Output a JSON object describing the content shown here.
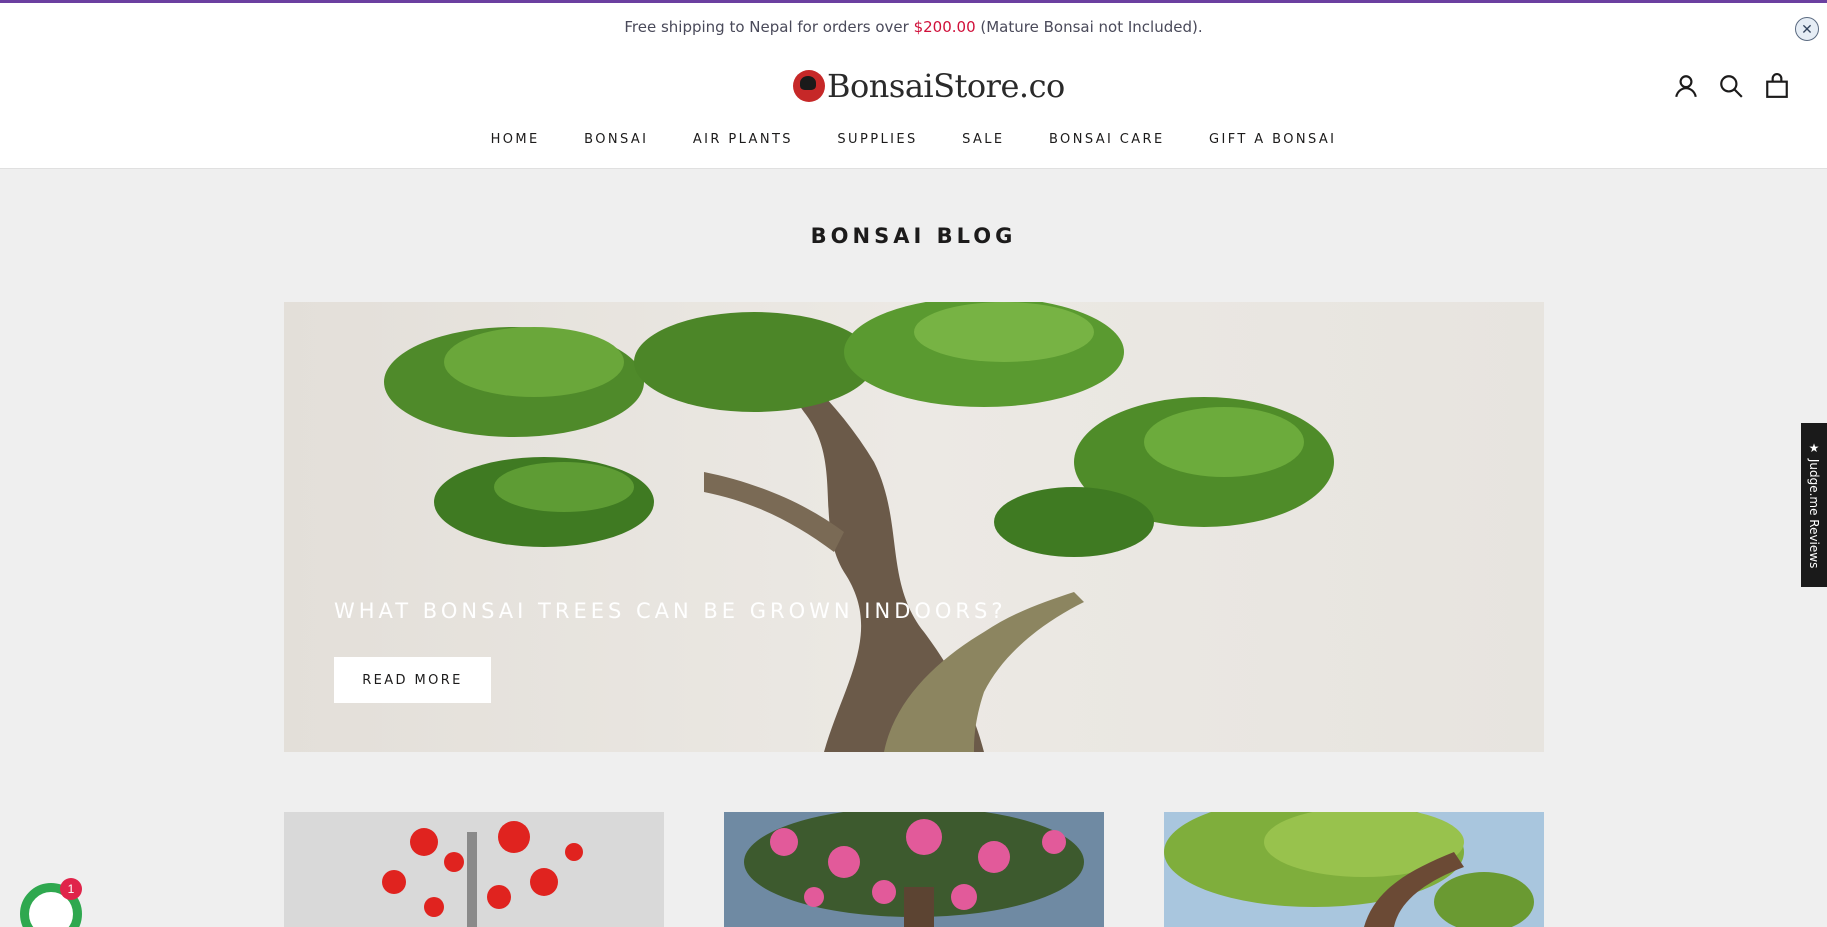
{
  "announcement": {
    "text_before": "Free shipping to Nepal for orders over ",
    "price": "$200.00",
    "text_after": " (Mature Bonsai not Included).",
    "close_icon": "close-circle-icon"
  },
  "header": {
    "logo_text": "BonsaiStore.co",
    "icons": [
      "account-icon",
      "search-icon",
      "cart-icon"
    ]
  },
  "nav": {
    "items": [
      "HOME",
      "BONSAI",
      "AIR PLANTS",
      "SUPPLIES",
      "SALE",
      "BONSAI CARE",
      "GIFT A BONSAI"
    ]
  },
  "page": {
    "title": "BONSAI BLOG"
  },
  "hero": {
    "title": "WHAT BONSAI TREES CAN BE GROWN INDOORS?",
    "button": "READ MORE"
  },
  "cards": [
    {
      "image": "red-maple-bonsai"
    },
    {
      "image": "pink-flowering-bonsai"
    },
    {
      "image": "jade-bonsai"
    }
  ],
  "widgets": {
    "reviews_tab": "★ Judge.me Reviews",
    "chat_badge": "1"
  }
}
